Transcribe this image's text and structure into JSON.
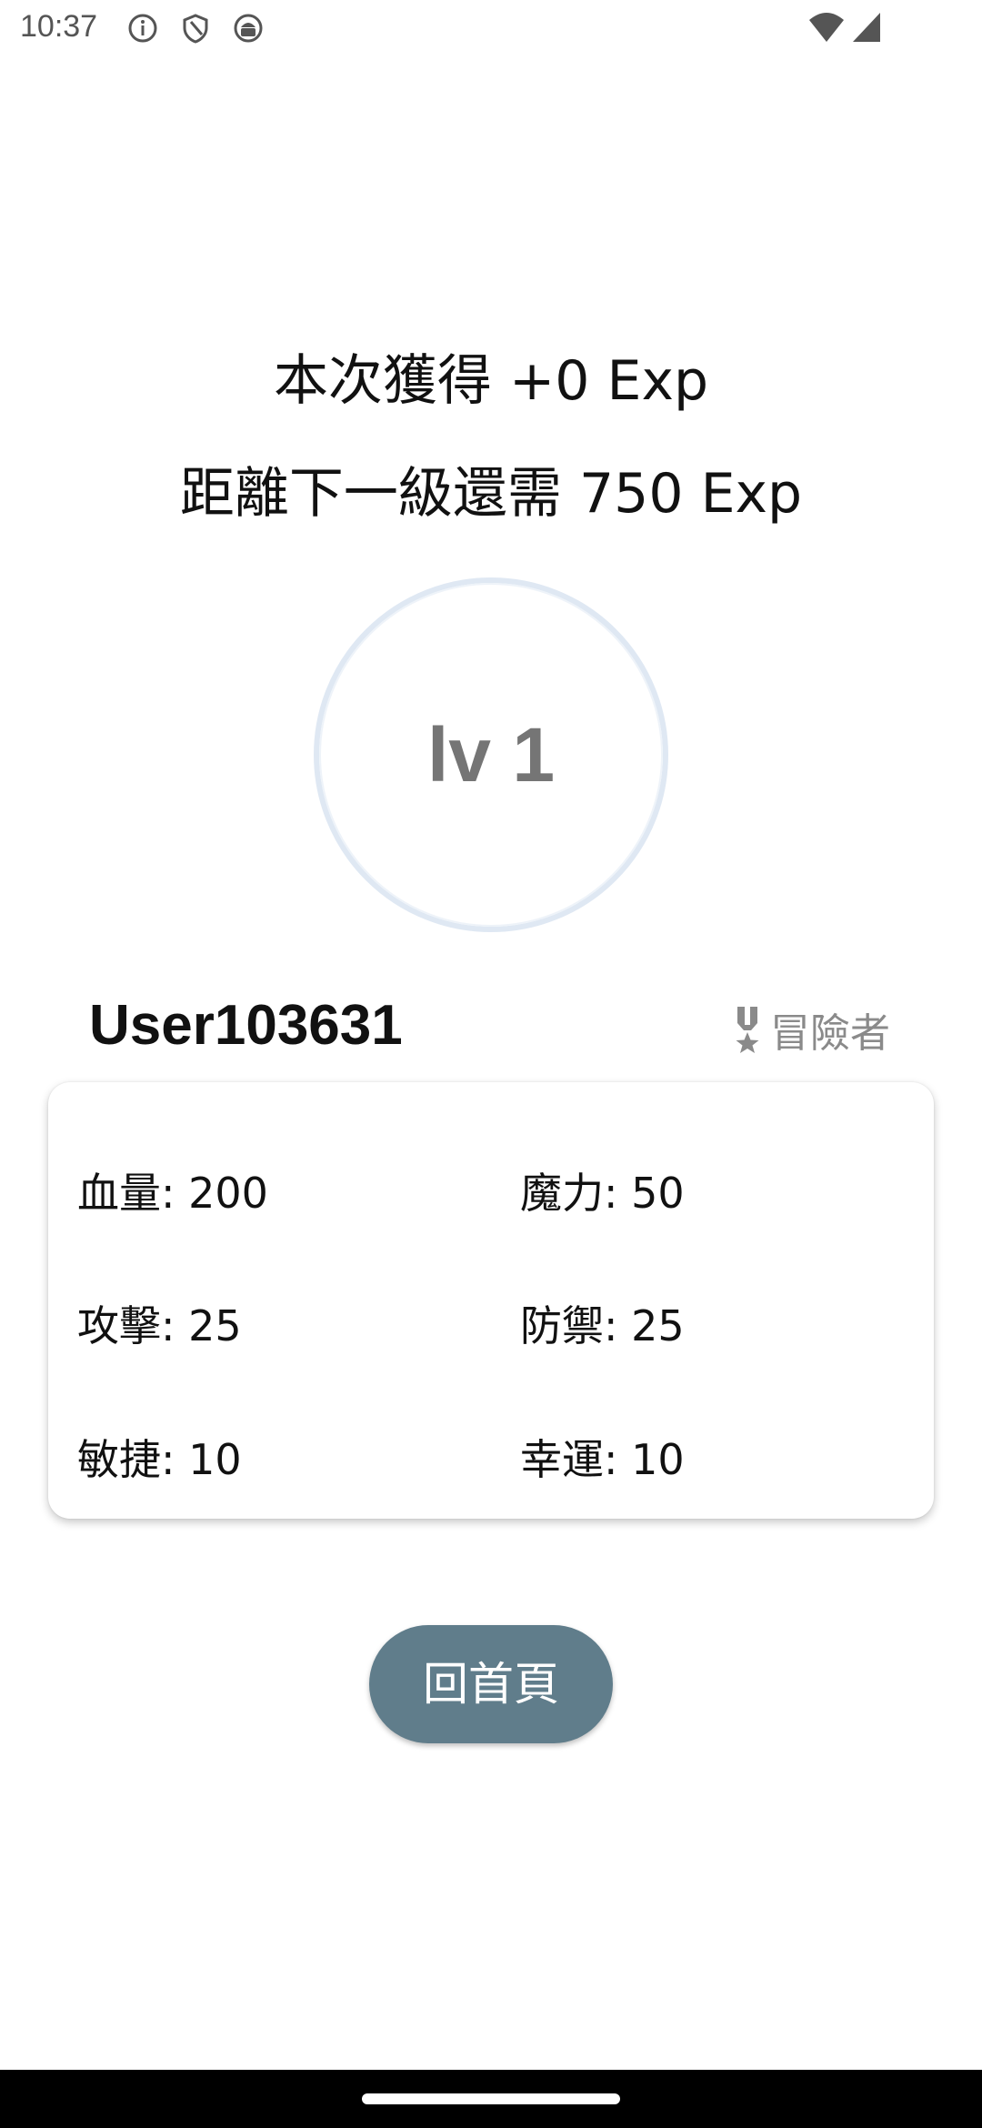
{
  "status_bar": {
    "time": "10:37",
    "left_icons": [
      "info-icon",
      "shield-icon",
      "android-icon"
    ],
    "right_icons": [
      "wifi-icon",
      "signal-icon"
    ]
  },
  "exp": {
    "gained": "本次獲得 +0 Exp",
    "to_next_level": "距離下一級還需 750 Exp"
  },
  "level": {
    "label": "lv 1",
    "progress": 0
  },
  "user": {
    "name": "User103631",
    "title": "冒險者",
    "title_icon": "medal-icon"
  },
  "stats": {
    "hp": "血量: 200",
    "mp": "魔力: 50",
    "attack": "攻擊: 25",
    "defense": "防禦: 25",
    "agility": "敏捷: 10",
    "luck": "幸運: 10"
  },
  "home_button": {
    "label": "回首頁"
  },
  "colors": {
    "button_bg": "#607d8b",
    "ring": "#dfe8f3",
    "level_text": "#757575",
    "title_text": "#8a8a8a"
  }
}
